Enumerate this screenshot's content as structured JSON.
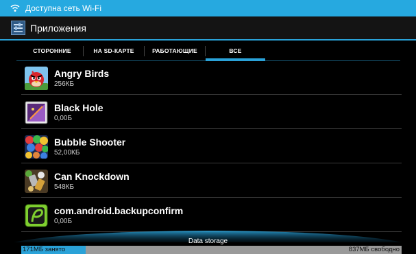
{
  "status_bar": {
    "text": "Доступна сеть Wi-Fi"
  },
  "action_bar": {
    "title": "Приложения"
  },
  "tabs": [
    {
      "label": "СТОРОННИЕ"
    },
    {
      "label": "НА SD-КАРТЕ"
    },
    {
      "label": "РАБОТАЮЩИЕ"
    },
    {
      "label": "ВСЕ",
      "selected": true
    }
  ],
  "apps": [
    {
      "name": "Angry Birds",
      "size": "256КБ",
      "icon": "angry-birds-icon"
    },
    {
      "name": "Black Hole",
      "size": "0,00Б",
      "icon": "black-hole-icon"
    },
    {
      "name": "Bubble Shooter",
      "size": "52,00КБ",
      "icon": "bubble-shooter-icon"
    },
    {
      "name": "Can Knockdown",
      "size": "548КБ",
      "icon": "can-knockdown-icon"
    },
    {
      "name": "com.android.backupconfirm",
      "size": "0,00Б",
      "icon": "backupconfirm-icon"
    }
  ],
  "storage": {
    "label": "Data storage",
    "used": "171МБ занято",
    "free": "837МБ свободно",
    "used_fraction": 0.17
  },
  "colors": {
    "accent": "#2aa2d8",
    "status_bar": "#26a9e0"
  }
}
